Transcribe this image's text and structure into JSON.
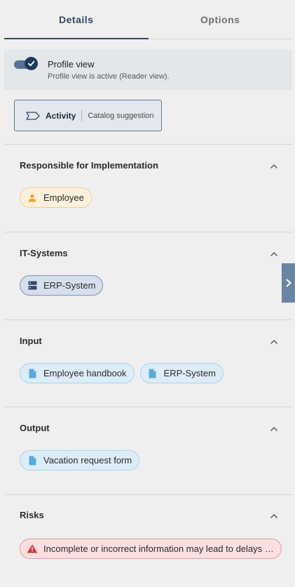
{
  "tabs": [
    {
      "label": "Details",
      "active": true
    },
    {
      "label": "Options",
      "active": false
    }
  ],
  "profile": {
    "title": "Profile view",
    "subtitle": "Profile view is active (Reader view).",
    "toggle_on": true
  },
  "activity": {
    "label": "Activity",
    "suggestion": "Catalog suggestion"
  },
  "sections": {
    "responsible": {
      "title": "Responsible for Implementation",
      "chips": [
        {
          "label": "Employee",
          "icon": "person-icon"
        }
      ]
    },
    "it_systems": {
      "title": "IT-Systems",
      "chips": [
        {
          "label": "ERP-System",
          "icon": "server-icon"
        }
      ]
    },
    "input": {
      "title": "Input",
      "chips": [
        {
          "label": "Employee handbook",
          "icon": "document-icon"
        },
        {
          "label": "ERP-System",
          "icon": "document-icon"
        }
      ]
    },
    "output": {
      "title": "Output",
      "chips": [
        {
          "label": "Vacation request form",
          "icon": "document-icon"
        }
      ]
    },
    "risks": {
      "title": "Risks",
      "chips": [
        {
          "label": "Incomplete or incorrect information may lead to delays …",
          "icon": "warning-icon"
        }
      ]
    }
  },
  "colors": {
    "accent": "#2e4a66",
    "person_chip": "#fdf0dc",
    "system_chip": "#d6e0ec",
    "document_chip": "#dcedf8",
    "risk_chip": "#fbdfe0",
    "risk_icon": "#d0393e"
  }
}
